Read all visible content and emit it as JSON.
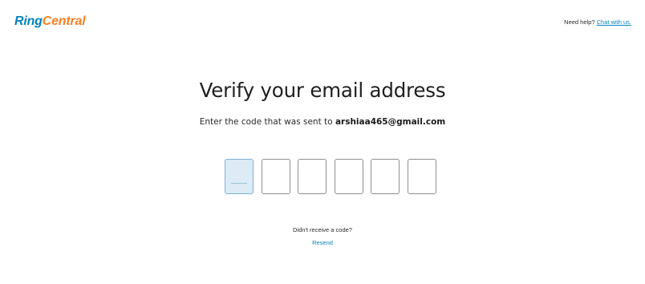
{
  "header": {
    "logo_part1": "Ring",
    "logo_part2": "Central",
    "help_text": "Need help?",
    "help_link": "Chat with us."
  },
  "main": {
    "title": "Verify your email address",
    "subtitle_prefix": "Enter the code that was sent to",
    "email": "arshiaa465@gmail.com",
    "code_digits": [
      "",
      "",
      "",
      "",
      "",
      ""
    ],
    "active_digit_index": 0
  },
  "footer": {
    "no_code_text": "Didn't receive a code?",
    "resend_label": "Resend"
  },
  "colors": {
    "brand_blue": "#0684bc",
    "brand_orange": "#f58025",
    "active_box_bg": "#dcebf5"
  }
}
